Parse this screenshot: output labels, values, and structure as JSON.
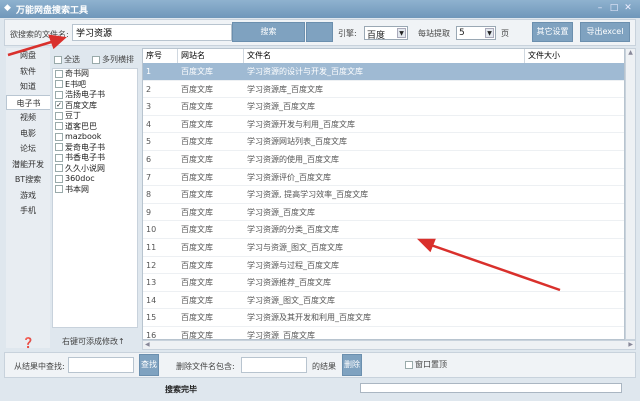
{
  "window": {
    "title": "万能网盘搜索工具"
  },
  "toolbar": {
    "filename_label": "欲搜索的文件名:",
    "filename_value": "学习资源",
    "search_label": "搜索",
    "engine_label": "引擎:",
    "engine_value": "百度",
    "per_site_label": "每站提取",
    "per_site_value": "5",
    "pages_unit": "页",
    "other_settings_label": "其它设置",
    "export_label": "导出excel"
  },
  "categories": [
    "网盘",
    "软件",
    "知道",
    "电子书",
    "视频",
    "电影",
    "论坛",
    "潜能开发",
    "BT搜索",
    "游戏",
    "手机"
  ],
  "active_category": "电子书",
  "sites_panel": {
    "select_all": "全选",
    "multi_column": "多列横排",
    "hint": "右键可添成修改↑",
    "sites": [
      {
        "name": "奇书网",
        "checked": false
      },
      {
        "name": "E书吧",
        "checked": false
      },
      {
        "name": "浩扬电子书",
        "checked": false
      },
      {
        "name": "百度文库",
        "checked": true
      },
      {
        "name": "豆丁",
        "checked": false
      },
      {
        "name": "道客巴巴",
        "checked": false
      },
      {
        "name": "mazbook",
        "checked": false
      },
      {
        "name": "爱奇电子书",
        "checked": false
      },
      {
        "name": "书香电子书",
        "checked": false
      },
      {
        "name": "久久小说网",
        "checked": false
      },
      {
        "name": "360doc",
        "checked": false
      },
      {
        "name": "书本网",
        "checked": false
      }
    ]
  },
  "table": {
    "columns": [
      "序号",
      "网站名",
      "文件名",
      "文件大小"
    ],
    "rows": [
      [
        "1",
        "百度文库",
        "学习资源的设计与开发_百度文库",
        ""
      ],
      [
        "2",
        "百度文库",
        "学习资源库_百度文库",
        ""
      ],
      [
        "3",
        "百度文库",
        "学习资源_百度文库",
        ""
      ],
      [
        "4",
        "百度文库",
        "学习资源开发与利用_百度文库",
        ""
      ],
      [
        "5",
        "百度文库",
        "学习资源网站列表_百度文库",
        ""
      ],
      [
        "6",
        "百度文库",
        "学习资源的使用_百度文库",
        ""
      ],
      [
        "7",
        "百度文库",
        "学习资源评价_百度文库",
        ""
      ],
      [
        "8",
        "百度文库",
        "学习资源, 提高学习效率_百度文库",
        ""
      ],
      [
        "9",
        "百度文库",
        "学习资源_百度文库",
        ""
      ],
      [
        "10",
        "百度文库",
        "学习资源的分类_百度文库",
        ""
      ],
      [
        "11",
        "百度文库",
        "学习与资源_图文_百度文库",
        ""
      ],
      [
        "12",
        "百度文库",
        "学习资源与过程_百度文库",
        ""
      ],
      [
        "13",
        "百度文库",
        "学习资源推荐_百度文库",
        ""
      ],
      [
        "14",
        "百度文库",
        "学习资源_图文_百度文库",
        ""
      ],
      [
        "15",
        "百度文库",
        "学习资源及其开发和利用_百度文库",
        ""
      ],
      [
        "16",
        "百度文库",
        "学习资源_百度文库",
        ""
      ]
    ],
    "selected_row": 0
  },
  "bottom": {
    "find_label": "从结果中查找:",
    "find_value": "",
    "find_button": "查找",
    "exclude_label": "删除文件名包含:",
    "exclude_value": "",
    "exclude_suffix": "的结果",
    "delete_button": "删除",
    "topmost_label": "窗口置顶",
    "topmost_checked": false
  },
  "status": {
    "text": "搜索完毕",
    "progress": 0
  },
  "colors": {
    "accent": "#7fa2c0",
    "selection": "#9fbad3",
    "annotation_arrow": "#d9302c"
  }
}
